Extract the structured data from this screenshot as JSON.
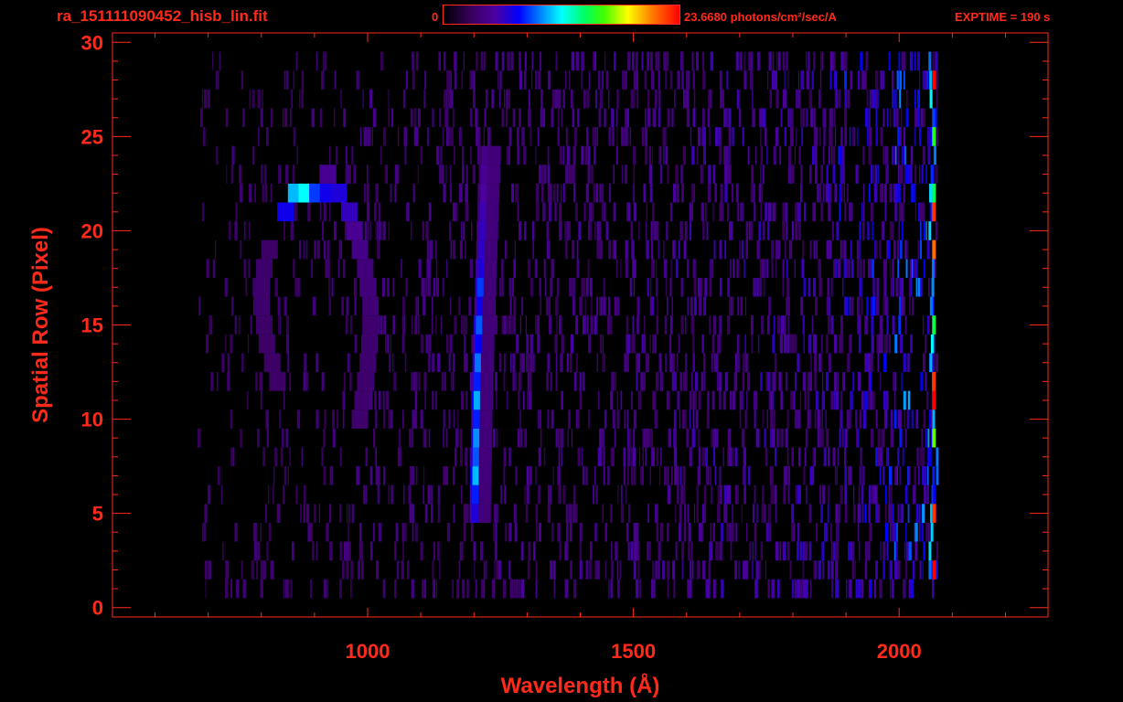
{
  "header": {
    "title": "ra_151111090452_hisb_lin.fit",
    "colorbar_min": "0",
    "colorbar_max": "23.6680 photons/cm²/sec/A",
    "exptime": "EXPTIME = 190 s"
  },
  "colors": {
    "axis": "#ff2a1a",
    "background": "#000000"
  },
  "chart_data": {
    "type": "heatmap",
    "title": "ra_151111090452_hisb_lin.fit",
    "xlabel": "Wavelength (Å)",
    "ylabel": "Spatial Row (Pixel)",
    "xlim": [
      520,
      2280
    ],
    "ylim": [
      -0.5,
      30.5
    ],
    "xticks": [
      1000,
      1500,
      2000
    ],
    "yticks": [
      0,
      5,
      10,
      15,
      20,
      25,
      30
    ],
    "colorbar": {
      "min": 0,
      "max": 23.668,
      "unit": "photons/cm²/sec/A",
      "colormap": "rainbow"
    },
    "features": [
      {
        "name": "Lyman-alpha line",
        "wavelength": 1216,
        "rows": [
          5,
          24
        ],
        "peak_rows": [
          7,
          9,
          10,
          11,
          13,
          15,
          17
        ]
      },
      {
        "name": "arc emission",
        "wavelength_range": [
          790,
          1000
        ],
        "rows": [
          10,
          24
        ],
        "peak_rows": [
          22
        ]
      },
      {
        "name": "long-wavelength continuum",
        "wavelength_range": [
          1700,
          2070
        ],
        "rows": [
          2,
          30
        ]
      }
    ]
  }
}
